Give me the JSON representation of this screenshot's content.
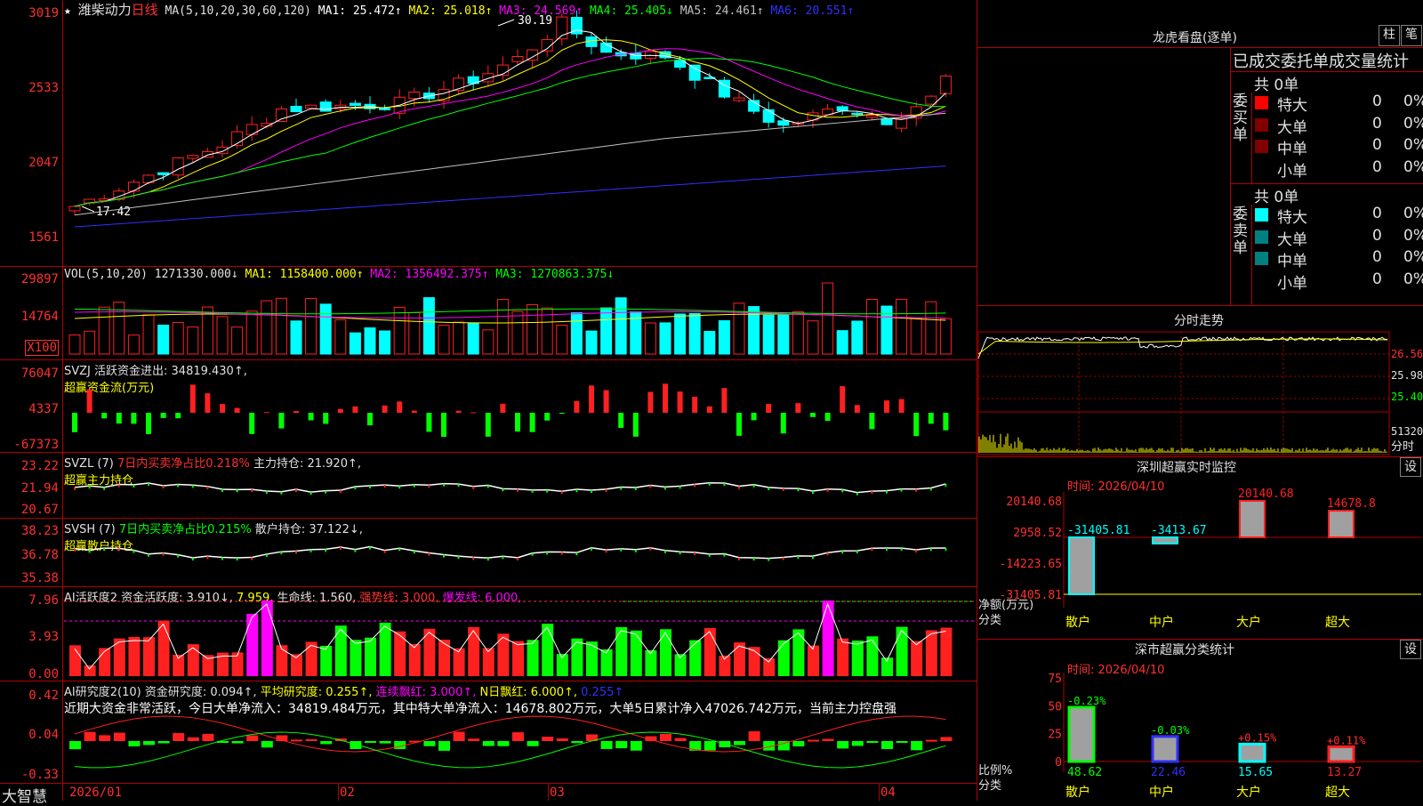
{
  "colors": {
    "up": "#ff2020",
    "down": "#00ffff",
    "grid": "#b00000",
    "ma1": "#ffffff",
    "ma2": "#ffff00",
    "ma3": "#ff00ff",
    "ma4": "#00ff00",
    "ma5": "#c0c0c0",
    "ma6": "#3030ff"
  },
  "header": {
    "star": "★",
    "name": "潍柴动力",
    "period": "日线",
    "ma_title": "MA(5,10,20,30,60,120)",
    "ma1": "MA1: 25.472↑",
    "ma2": "MA2: 25.018↑",
    "ma3": "MA3: 24.569↑",
    "ma4": "MA4: 25.405↓",
    "ma5": "MA5: 24.461↑",
    "ma6": "MA6: 20.551↑"
  },
  "price_axis": [
    "3019",
    "2533",
    "2047",
    "1561"
  ],
  "price_high": "30.19",
  "price_low": "17.42",
  "vol": {
    "title": "VOL(5,10,20)",
    "value": "1271330.000↓",
    "ma1": "MA1: 1158400.000↑",
    "ma2": "MA2: 1356492.375↑",
    "ma3": "MA3: 1270863.375↓",
    "axis": [
      "29897",
      "14764",
      "X100"
    ]
  },
  "svzj": {
    "title": "SVZJ  活跃资金进出: 34819.430↑,",
    "sub": "超赢资金流(万元)",
    "axis": [
      "76047",
      "4337",
      "-67373"
    ]
  },
  "svzl": {
    "title": "SVZL (7)",
    "pct": "7日内买卖净占比0.218%",
    "hold": "主力持仓: 21.920↑,",
    "sub": "超赢主力持仓",
    "axis": [
      "23.22",
      "21.94",
      "20.67"
    ]
  },
  "svsh": {
    "title": "SVSH (7)",
    "pct": "7日内买卖净占比0.215%",
    "hold": "散户持仓: 37.122↓,",
    "sub": "超赢散户持仓",
    "axis": [
      "38.23",
      "36.78",
      "35.38"
    ]
  },
  "ai1": {
    "title": "AI活跃度2 资金活跃度: 3.910↓,",
    "v2": "7.959,",
    "life": "生命线: 1.560,",
    "strong": "强势线: 3.000,",
    "burst": "爆发线: 6.000,",
    "axis": [
      "7.96",
      "3.93",
      "0.00"
    ]
  },
  "ai2": {
    "title": "AI研究度2(10) 资金研究度: 0.094↑,",
    "avg": "平均研究度: 0.255↑,",
    "red": "连续飘红: 3.000↑,",
    "nred": "N日飘红: 6.000↑,",
    "v": "0.255↑",
    "desc": "近期大资金非常活跃，今日大单净流入：34819.484万元，其中特大单净流入：14678.802万元，大单5日累计净入47026.742万元，当前主力控盘强",
    "axis": [
      "0.42",
      "0.04",
      "-0.33"
    ]
  },
  "dates": [
    "2026/01",
    "02",
    "03",
    "04"
  ],
  "logo": "大智慧",
  "right": {
    "lhb_title": "龙虎看盘(逐单)",
    "btn1": "柱",
    "btn2": "笔",
    "tabs": "已成交委托单成交量统计",
    "buy_label": "委买单",
    "sell_label": "委卖单",
    "buy_total": "共 0单",
    "sell_total": "共 0单",
    "buy_rows": [
      {
        "name": "特大",
        "v": "0",
        "p": "0%"
      },
      {
        "name": "大单",
        "v": "0",
        "p": "0%"
      },
      {
        "name": "中单",
        "v": "0",
        "p": "0%"
      },
      {
        "name": "小单",
        "v": "0",
        "p": "0%"
      }
    ],
    "sell_rows": [
      {
        "name": "特大",
        "v": "0",
        "p": "0%"
      },
      {
        "name": "大单",
        "v": "0",
        "p": "0%"
      },
      {
        "name": "中单",
        "v": "0",
        "p": "0%"
      },
      {
        "name": "小单",
        "v": "0",
        "p": "0%"
      }
    ],
    "intraday_title": "分时走势",
    "intraday_axis": [
      "26.56",
      "25.98",
      "25.40"
    ],
    "intraday_vol": "51320",
    "intraday_unit": "分时",
    "sz_title": "深圳超赢实时监控",
    "sz_btn": "设",
    "sz_time": "时间: 2026/04/10",
    "sz_axis": [
      "20140.68",
      "2958.52",
      "-14223.65",
      "-31405.81"
    ],
    "sz_ylabel": "净额(万元)",
    "sz_xlabel": "分类",
    "cls_title": "深市超赢分类统计",
    "cls_btn": "设",
    "cls_time": "时间: 2026/04/10",
    "cls_axis": [
      "75",
      "50",
      "25",
      "0"
    ],
    "cls_ylabel": "比例%",
    "cls_xlabel": "分类"
  },
  "chart_data": [
    {
      "type": "bar",
      "title": "深圳超赢实时监控",
      "categories": [
        "散户",
        "中户",
        "大户",
        "超大"
      ],
      "values": [
        -31405.81,
        -3413.67,
        20140.68,
        14678.8
      ],
      "ylim": [
        -31405.81,
        20140.68
      ]
    },
    {
      "type": "bar",
      "title": "深市超赢分类统计",
      "categories": [
        "散户",
        "中户",
        "大户",
        "超大"
      ],
      "values": [
        48.62,
        22.46,
        15.65,
        13.27
      ],
      "changes": [
        "-0.23%",
        "-0.03%",
        "+0.15%",
        "+0.11%"
      ],
      "ylim": [
        0,
        75
      ]
    }
  ]
}
